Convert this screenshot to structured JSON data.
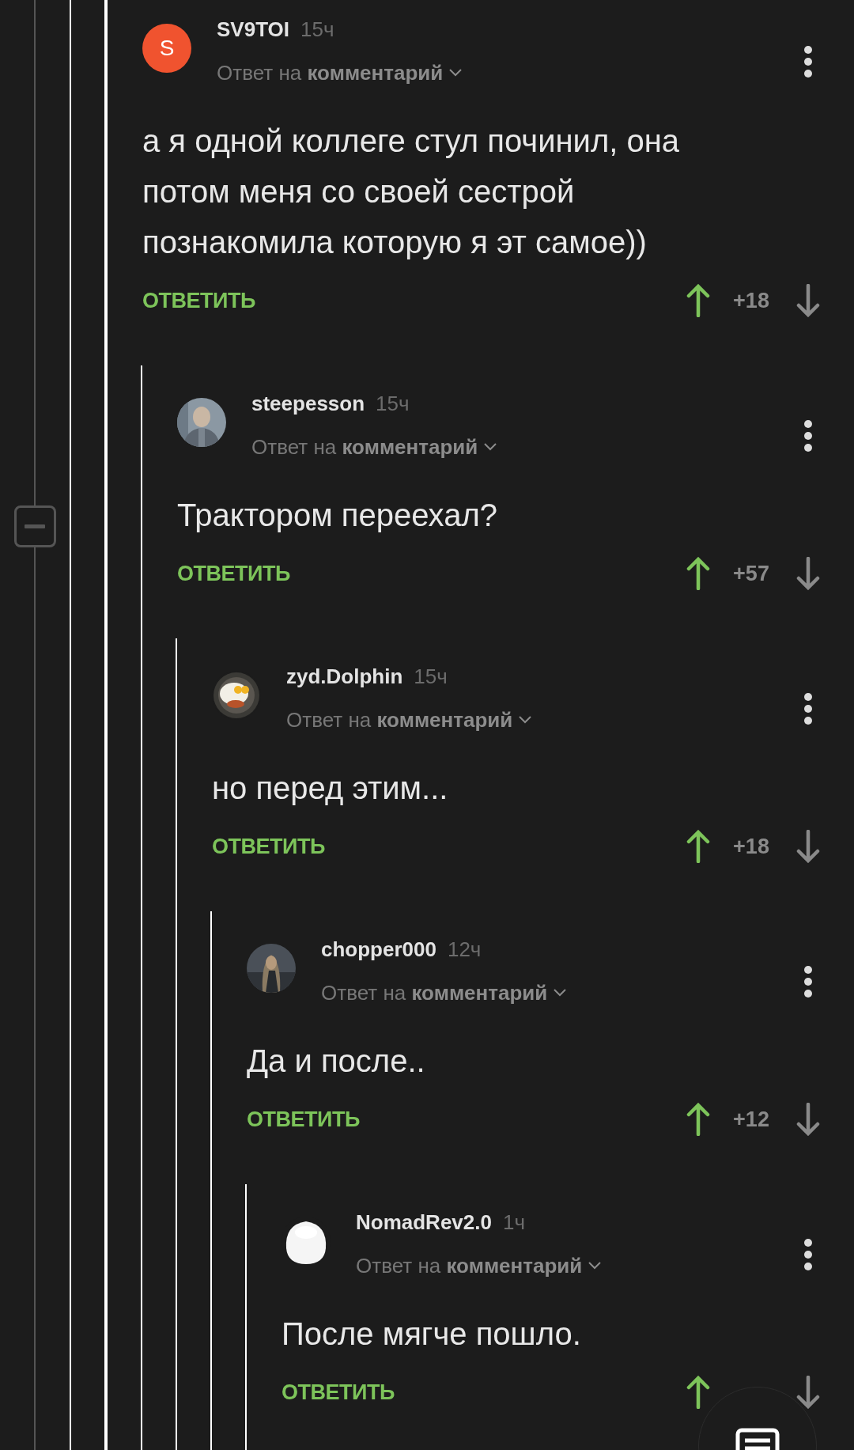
{
  "collapse_button": {
    "expanded": true
  },
  "comments": [
    {
      "author": "SV9TOI",
      "time": "15ч",
      "reply_to": "Ответ на **комментарий**",
      "avatar": {
        "kind": "letter",
        "letter": "S"
      },
      "body": "а я одной коллеге стул починил, она потом меня со своей сестрой познакомила которую я эт самое))",
      "reply_label": "ОТВЕТИТЬ",
      "score": "+18",
      "children": [
        {
          "author": "steepesson",
          "time": "15ч",
          "reply_to": "Ответ на **комментарий**",
          "body": "Трактором переехал?",
          "reply_label": "ОТВЕТИТЬ",
          "score": "+57",
          "children": [
            {
              "author": "zyd.Dolphin",
              "time": "15ч",
              "reply_to": "Ответ на **комментарий**",
              "body": "но перед этим...",
              "reply_label": "ОТВЕТИТЬ",
              "score": "+18",
              "children": [
                {
                  "author": "chopper000",
                  "time": "12ч",
                  "reply_to": "Ответ на **комментарий**",
                  "body": "Да и после..",
                  "reply_label": "ОТВЕТИТЬ",
                  "score": "+12",
                  "children": [
                    {
                      "author": "NomadRev2.0",
                      "time": "1ч",
                      "reply_to": "Ответ на **комментарий**",
                      "body": "После мягче пошло.",
                      "reply_label": "ОТВЕТИТЬ"
                    }
                  ]
                }
              ]
            }
          ]
        }
      ]
    }
  ]
}
